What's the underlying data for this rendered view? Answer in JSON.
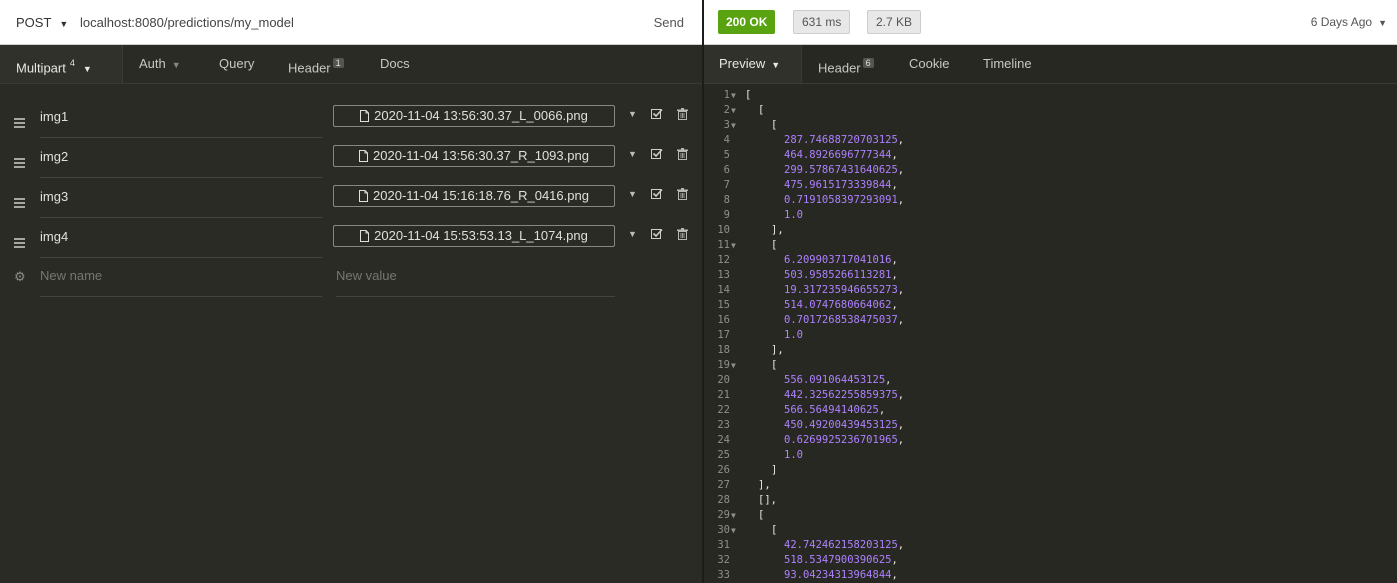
{
  "request": {
    "method": "POST",
    "url": "localhost:8080/predictions/my_model",
    "send_label": "Send",
    "tabs": [
      {
        "label": "Multipart",
        "badge": "4"
      },
      {
        "label": "Auth"
      },
      {
        "label": "Query"
      },
      {
        "label": "Header",
        "badge": "1"
      },
      {
        "label": "Docs"
      }
    ],
    "rows": [
      {
        "name": "img1",
        "file": "2020-11-04 13:56:30.37_L_0066.png"
      },
      {
        "name": "img2",
        "file": "2020-11-04 13:56:30.37_R_1093.png"
      },
      {
        "name": "img3",
        "file": "2020-11-04 15:16:18.76_R_0416.png"
      },
      {
        "name": "img4",
        "file": "2020-11-04 15:53:53.13_L_1074.png"
      }
    ],
    "new_name_placeholder": "New name",
    "new_value_placeholder": "New value"
  },
  "response": {
    "status": "200 OK",
    "time": "631 ms",
    "size": "2.7 KB",
    "age": "6 Days Ago",
    "tabs": [
      {
        "label": "Preview"
      },
      {
        "label": "Header",
        "badge": "6"
      },
      {
        "label": "Cookie"
      },
      {
        "label": "Timeline"
      }
    ],
    "lines": [
      {
        "n": "1",
        "fold": true,
        "indent": 0,
        "text": "["
      },
      {
        "n": "2",
        "fold": true,
        "indent": 1,
        "text": "["
      },
      {
        "n": "3",
        "fold": true,
        "indent": 2,
        "text": "["
      },
      {
        "n": "4",
        "indent": 3,
        "value": "287.74688720703125",
        "suffix": ","
      },
      {
        "n": "5",
        "indent": 3,
        "value": "464.8926696777344",
        "suffix": ","
      },
      {
        "n": "6",
        "indent": 3,
        "value": "299.57867431640625",
        "suffix": ","
      },
      {
        "n": "7",
        "indent": 3,
        "value": "475.9615173339844",
        "suffix": ","
      },
      {
        "n": "8",
        "indent": 3,
        "value": "0.7191058397293091",
        "suffix": ","
      },
      {
        "n": "9",
        "indent": 3,
        "value": "1.0",
        "suffix": ""
      },
      {
        "n": "10",
        "indent": 2,
        "text": "],"
      },
      {
        "n": "11",
        "fold": true,
        "indent": 2,
        "text": "["
      },
      {
        "n": "12",
        "indent": 3,
        "value": "6.209903717041016",
        "suffix": ","
      },
      {
        "n": "13",
        "indent": 3,
        "value": "503.9585266113281",
        "suffix": ","
      },
      {
        "n": "14",
        "indent": 3,
        "value": "19.317235946655273",
        "suffix": ","
      },
      {
        "n": "15",
        "indent": 3,
        "value": "514.0747680664062",
        "suffix": ","
      },
      {
        "n": "16",
        "indent": 3,
        "value": "0.7017268538475037",
        "suffix": ","
      },
      {
        "n": "17",
        "indent": 3,
        "value": "1.0",
        "suffix": ""
      },
      {
        "n": "18",
        "indent": 2,
        "text": "],"
      },
      {
        "n": "19",
        "fold": true,
        "indent": 2,
        "text": "["
      },
      {
        "n": "20",
        "indent": 3,
        "value": "556.091064453125",
        "suffix": ","
      },
      {
        "n": "21",
        "indent": 3,
        "value": "442.32562255859375",
        "suffix": ","
      },
      {
        "n": "22",
        "indent": 3,
        "value": "566.56494140625",
        "suffix": ","
      },
      {
        "n": "23",
        "indent": 3,
        "value": "450.49200439453125",
        "suffix": ","
      },
      {
        "n": "24",
        "indent": 3,
        "value": "0.6269925236701965",
        "suffix": ","
      },
      {
        "n": "25",
        "indent": 3,
        "value": "1.0",
        "suffix": ""
      },
      {
        "n": "26",
        "indent": 2,
        "text": "]"
      },
      {
        "n": "27",
        "indent": 1,
        "text": "],"
      },
      {
        "n": "28",
        "indent": 1,
        "text": "[],"
      },
      {
        "n": "29",
        "fold": true,
        "indent": 1,
        "text": "["
      },
      {
        "n": "30",
        "fold": true,
        "indent": 2,
        "text": "["
      },
      {
        "n": "31",
        "indent": 3,
        "value": "42.742462158203125",
        "suffix": ","
      },
      {
        "n": "32",
        "indent": 3,
        "value": "518.5347900390625",
        "suffix": ","
      },
      {
        "n": "33",
        "indent": 3,
        "value": "93.04234313964844",
        "suffix": ","
      }
    ]
  },
  "colors": {
    "status_ok": "#59a210",
    "editor_bg": "#272822",
    "json_number": "#ae81ff"
  }
}
